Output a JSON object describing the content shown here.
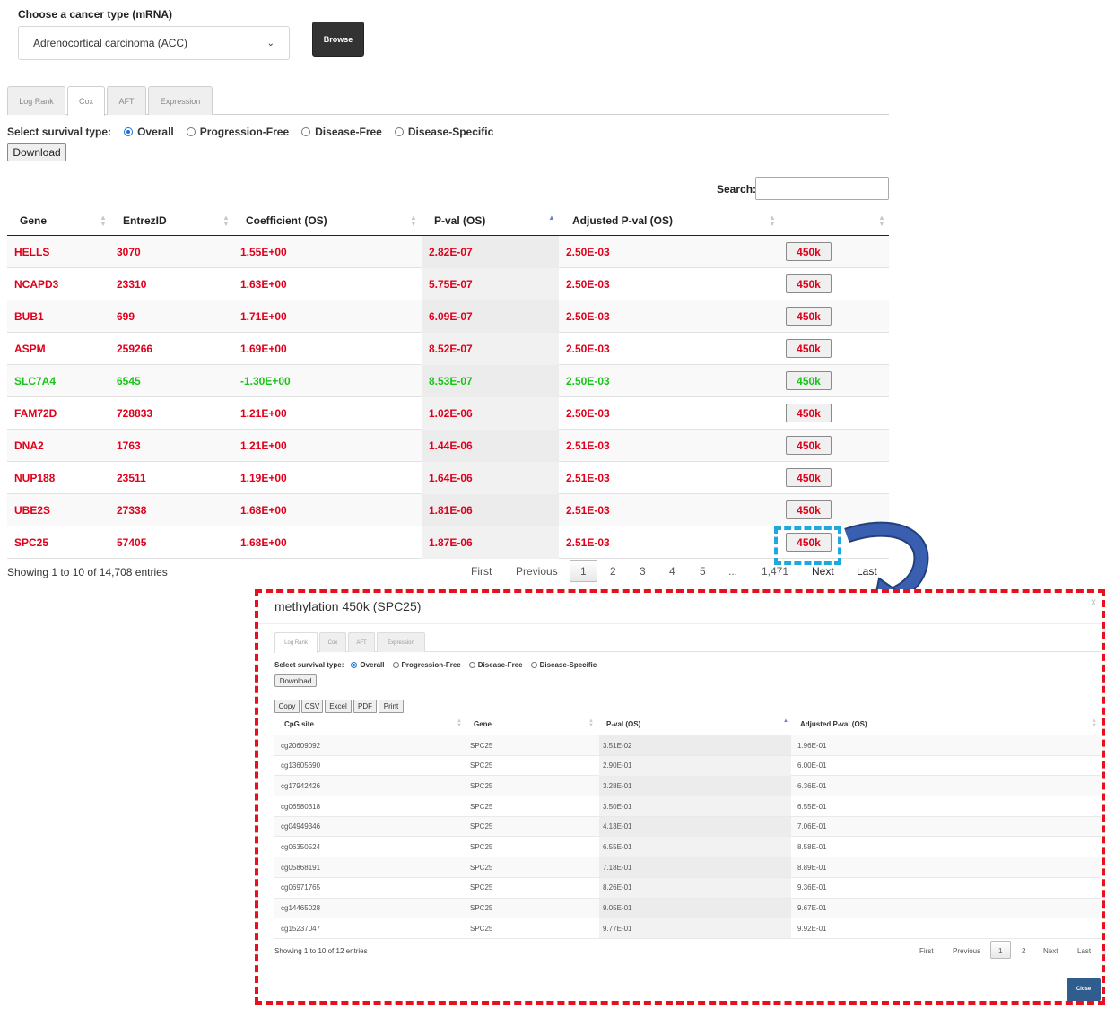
{
  "selector": {
    "label": "Choose a cancer type (mRNA)",
    "selected": "Adrenocortical carcinoma (ACC)",
    "browse_label": "Browse"
  },
  "tabs": [
    "Log Rank",
    "Cox",
    "AFT",
    "Expression"
  ],
  "active_tab": "Cox",
  "survival": {
    "label": "Select survival type:",
    "options": [
      "Overall",
      "Progression-Free",
      "Disease-Free",
      "Disease-Specific"
    ],
    "selected": "Overall"
  },
  "download_label": "Download",
  "search_label": "Search:",
  "main_table": {
    "columns": [
      "Gene",
      "EntrezID",
      "Coefficient (OS)",
      "P-val (OS)",
      "Adjusted P-val (OS)",
      ""
    ],
    "sorted_column": "P-val (OS)",
    "button_label": "450k",
    "rows": [
      {
        "gene": "HELLS",
        "entrez": "3070",
        "coef": "1.55E+00",
        "pval": "2.82E-07",
        "adj": "2.50E-03",
        "color": "red"
      },
      {
        "gene": "NCAPD3",
        "entrez": "23310",
        "coef": "1.63E+00",
        "pval": "5.75E-07",
        "adj": "2.50E-03",
        "color": "red"
      },
      {
        "gene": "BUB1",
        "entrez": "699",
        "coef": "1.71E+00",
        "pval": "6.09E-07",
        "adj": "2.50E-03",
        "color": "red"
      },
      {
        "gene": "ASPM",
        "entrez": "259266",
        "coef": "1.69E+00",
        "pval": "8.52E-07",
        "adj": "2.50E-03",
        "color": "red"
      },
      {
        "gene": "SLC7A4",
        "entrez": "6545",
        "coef": "-1.30E+00",
        "pval": "8.53E-07",
        "adj": "2.50E-03",
        "color": "green"
      },
      {
        "gene": "FAM72D",
        "entrez": "728833",
        "coef": "1.21E+00",
        "pval": "1.02E-06",
        "adj": "2.50E-03",
        "color": "red"
      },
      {
        "gene": "DNA2",
        "entrez": "1763",
        "coef": "1.21E+00",
        "pval": "1.44E-06",
        "adj": "2.51E-03",
        "color": "red"
      },
      {
        "gene": "NUP188",
        "entrez": "23511",
        "coef": "1.19E+00",
        "pval": "1.64E-06",
        "adj": "2.51E-03",
        "color": "red"
      },
      {
        "gene": "UBE2S",
        "entrez": "27338",
        "coef": "1.68E+00",
        "pval": "1.81E-06",
        "adj": "2.51E-03",
        "color": "red"
      },
      {
        "gene": "SPC25",
        "entrez": "57405",
        "coef": "1.68E+00",
        "pval": "1.87E-06",
        "adj": "2.51E-03",
        "color": "red"
      }
    ],
    "info": "Showing 1 to 10 of 14,708 entries",
    "pagination": [
      "First",
      "Previous",
      "1",
      "2",
      "3",
      "4",
      "5",
      "...",
      "1,471",
      "Next",
      "Last"
    ],
    "current_page": "1"
  },
  "modal": {
    "title": "methylation 450k (SPC25)",
    "close_x": "x",
    "tabs": [
      "Log Rank",
      "Cox",
      "AFT",
      "Expression"
    ],
    "active_tab": "Log Rank",
    "survival_label": "Select survival type:",
    "survival_options": [
      "Overall",
      "Progression-Free",
      "Disease-Free",
      "Disease-Specific"
    ],
    "survival_selected": "Overall",
    "download_label": "Download",
    "export_buttons": [
      "Copy",
      "CSV",
      "Excel",
      "PDF",
      "Print"
    ],
    "columns": [
      "CpG site",
      "Gene",
      "P-val (OS)",
      "Adjusted P-val (OS)"
    ],
    "rows": [
      {
        "cpg": "cg20609092",
        "gene": "SPC25",
        "pval": "3.51E-02",
        "adj": "1.96E-01"
      },
      {
        "cpg": "cg13605690",
        "gene": "SPC25",
        "pval": "2.90E-01",
        "adj": "6.00E-01"
      },
      {
        "cpg": "cg17942426",
        "gene": "SPC25",
        "pval": "3.28E-01",
        "adj": "6.36E-01"
      },
      {
        "cpg": "cg06580318",
        "gene": "SPC25",
        "pval": "3.50E-01",
        "adj": "6.55E-01"
      },
      {
        "cpg": "cg04949346",
        "gene": "SPC25",
        "pval": "4.13E-01",
        "adj": "7.06E-01"
      },
      {
        "cpg": "cg06350524",
        "gene": "SPC25",
        "pval": "6.55E-01",
        "adj": "8.58E-01"
      },
      {
        "cpg": "cg05868191",
        "gene": "SPC25",
        "pval": "7.18E-01",
        "adj": "8.89E-01"
      },
      {
        "cpg": "cg06971765",
        "gene": "SPC25",
        "pval": "8.26E-01",
        "adj": "9.36E-01"
      },
      {
        "cpg": "cg14465028",
        "gene": "SPC25",
        "pval": "9.05E-01",
        "adj": "9.67E-01"
      },
      {
        "cpg": "cg15237047",
        "gene": "SPC25",
        "pval": "9.77E-01",
        "adj": "9.92E-01"
      }
    ],
    "info": "Showing 1 to 10 of 12 entries",
    "pagination": [
      "First",
      "Previous",
      "1",
      "2",
      "Next",
      "Last"
    ],
    "current_page": "1",
    "close_label": "Close"
  },
  "colors": {
    "red": "#e0001b",
    "green": "#19c419",
    "highlight_box": "#1fa8e0",
    "modal_border": "#e8101c",
    "arrow": "#3a5fb0",
    "close_button": "#2e5d8e"
  }
}
